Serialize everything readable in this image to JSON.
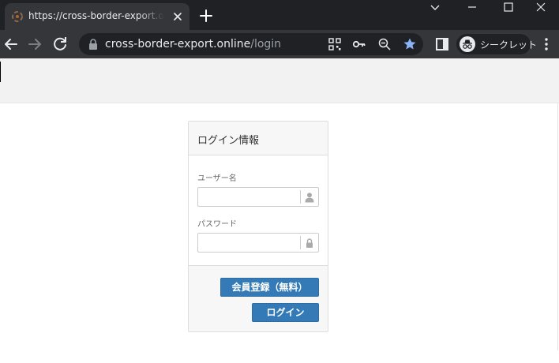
{
  "browser": {
    "tab": {
      "title": "https://cross-border-export.online/login"
    },
    "omnibox": {
      "host": "cross-border-export.online",
      "path": "/login"
    },
    "profile": {
      "label": "シークレット"
    },
    "colors": {
      "frame": "#202124",
      "toolbar": "#35363a",
      "star": "#8ab4f8"
    }
  },
  "login": {
    "title": "ログイン情報",
    "username": {
      "label": "ユーザー名",
      "value": "",
      "placeholder": "",
      "icon": "user-icon"
    },
    "password": {
      "label": "パスワード",
      "value": "",
      "placeholder": "",
      "icon": "lock-icon"
    },
    "register_label": "会員登録（無料）",
    "login_label": "ログイン"
  },
  "theme": {
    "primary": "#337ab7",
    "panel_bg": "#f7f7f7",
    "border": "#dddddd"
  }
}
